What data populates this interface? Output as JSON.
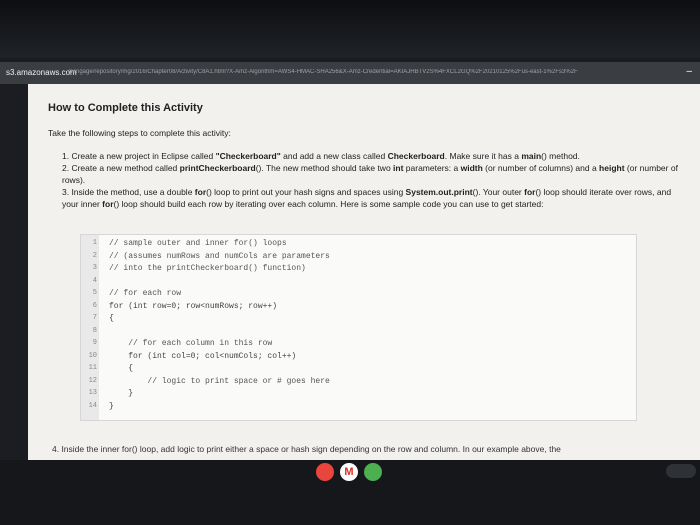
{
  "browser": {
    "host": "s3.amazonaws.com",
    "path": "/cengage/repository/mg/2016/Chapter08/Activity/C8A1.html?X-Amz-Algorithm=AWS4-HMAC-SHA256&X-Amz-Credential=AKIAJHBTV2S%4FXCL2GQ%2F20210125%2Fus-east-1%2Fs3%2F",
    "minimize_label": "–"
  },
  "page": {
    "heading": "How to Complete this Activity",
    "intro": "Take the following steps to complete this activity:",
    "steps": [
      [
        "1. Create a new project in Eclipse called ",
        {
          "b": "\"Checkerboard\""
        },
        " and add a new class called ",
        {
          "b": "Checkerboard"
        },
        ". Make sure it has a ",
        {
          "b": "main"
        },
        "() method."
      ],
      [
        "2. Create a new method called ",
        {
          "b": "printCheckerboard"
        },
        "(). The new method should take two ",
        {
          "b": "int"
        },
        " parameters: a ",
        {
          "b": "width"
        },
        " (or number of columns) and a ",
        {
          "b": "height"
        },
        " (or number of rows)."
      ],
      [
        "3. Inside the method, use a double ",
        {
          "b": "for"
        },
        "() loop to print out your hash signs and spaces using ",
        {
          "b": "System.out.print"
        },
        "(). Your outer ",
        {
          "b": "for"
        },
        "() loop should iterate over rows, and your inner ",
        {
          "b": "for"
        },
        "() loop should build each row by iterating over each column. Here is some sample code you can use to get started:"
      ]
    ],
    "step4_partial": "4. Inside the inner for() loop, add logic to print either a space or hash sign depending on the row and column. In our example above, the"
  },
  "code": [
    {
      "n": "1",
      "t": "// sample outer and inner for() loops"
    },
    {
      "n": "2",
      "t": "// (assumes numRows and numCols are parameters"
    },
    {
      "n": "3",
      "t": "// into the printCheckerboard() function)"
    },
    {
      "n": "4",
      "t": ""
    },
    {
      "n": "5",
      "t": "// for each row"
    },
    {
      "n": "6",
      "t": "for (int row=0; row<numRows; row++)"
    },
    {
      "n": "7",
      "t": "{"
    },
    {
      "n": "8",
      "t": ""
    },
    {
      "n": "9",
      "t": "    // for each column in this row"
    },
    {
      "n": "10",
      "t": "    for (int col=0; col<numCols; col++)"
    },
    {
      "n": "11",
      "t": "    {"
    },
    {
      "n": "12",
      "t": "        // logic to print space or # goes here"
    },
    {
      "n": "13",
      "t": "    }"
    },
    {
      "n": "14",
      "t": "}"
    }
  ],
  "shelf_apps": [
    {
      "name": "chrome-icon",
      "color": "#e8453c"
    },
    {
      "name": "gmail-icon",
      "color": "#ffffff",
      "glyph": "M"
    },
    {
      "name": "play-icon",
      "color": "#4caf50"
    }
  ],
  "colors": {
    "page_bg": "#f3f1ee",
    "code_comment": "#555555"
  }
}
